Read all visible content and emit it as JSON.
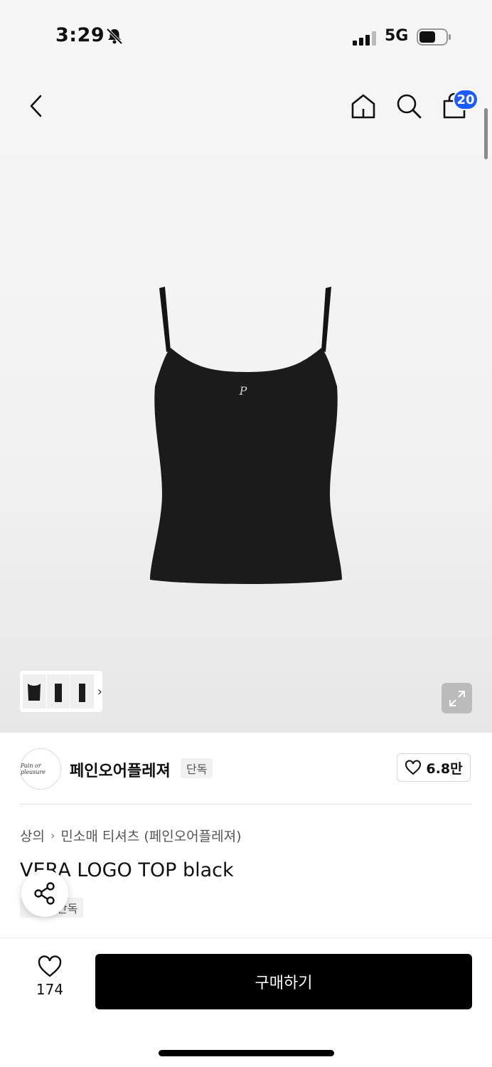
{
  "status_bar": {
    "time": "3:29",
    "network": "5G"
  },
  "nav": {
    "cart_count": "20"
  },
  "product": {
    "brand": "페인오어플레져",
    "brand_logo_text": "Pain or pleasure",
    "exclusive_label": "단독",
    "brand_likes": "6.8만",
    "breadcrumb": [
      "상의",
      "민소매 티셔츠 (페인오어플레져)"
    ],
    "title": "VERA LOGO TOP black",
    "thumbnails": 3
  },
  "bottom_bar": {
    "wish_count": "174",
    "buy_label": "구매하기"
  },
  "colors": {
    "badge": "#1a5cff",
    "buy_button": "#000000"
  }
}
